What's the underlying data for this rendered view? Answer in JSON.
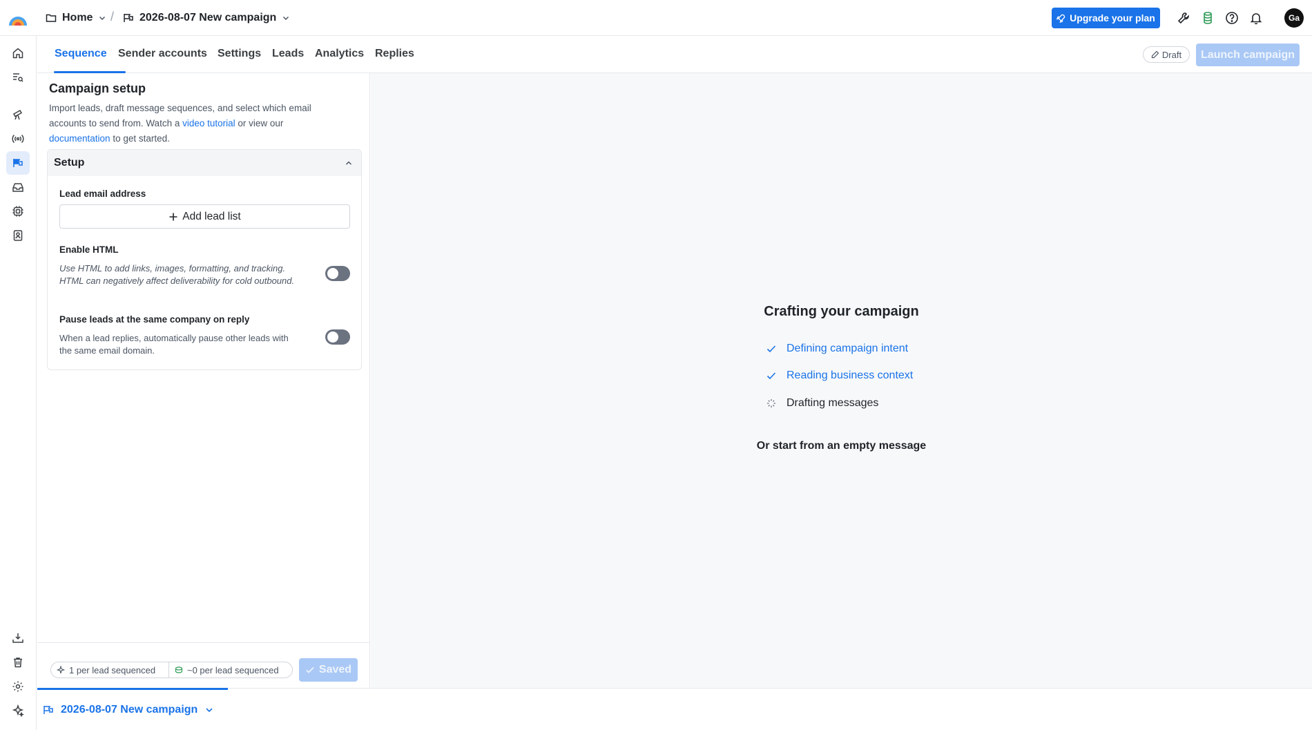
{
  "breadcrumb": {
    "home_label": "Home",
    "separator": "/",
    "campaign_label": "2026-08-07 New campaign"
  },
  "topbar": {
    "upgrade_label": "Upgrade your plan",
    "avatar_initials": "Ga",
    "icons": [
      "wrench-icon",
      "credits-icon",
      "help-icon",
      "bell-icon"
    ]
  },
  "colors": {
    "accent": "#1a73e8",
    "disabled_button": "#a9c8f5",
    "main_background": "#f7f8fa"
  },
  "tabs": [
    {
      "label": "Sequence",
      "active": true
    },
    {
      "label": "Sender accounts",
      "active": false
    },
    {
      "label": "Settings",
      "active": false
    },
    {
      "label": "Leads",
      "active": false
    },
    {
      "label": "Analytics",
      "active": false
    },
    {
      "label": "Replies",
      "active": false
    }
  ],
  "status": {
    "draft_label": "Draft",
    "launch_label": "Launch campaign"
  },
  "panel": {
    "title": "Campaign setup",
    "desc_part1": "Import leads, draft message sequences, and select which email accounts to send from. Watch a ",
    "video_link": "video tutorial",
    "desc_part2": " or view our ",
    "doc_link": "documentation",
    "desc_part3": " to get started.",
    "setup": {
      "header": "Setup",
      "lead_label": "Lead email address",
      "add_lead_label": "Add lead list",
      "html_label": "Enable HTML",
      "html_desc": "Use HTML to add links, images, formatting, and tracking. HTML can negatively affect deliverability for cold outbound.",
      "html_enabled": false,
      "pause_label": "Pause leads at the same company on reply",
      "pause_desc": "When a lead replies, automatically pause other leads with the same email domain.",
      "pause_enabled": false
    },
    "footer": {
      "credits_pill": "1 per lead sequenced",
      "cost_pill": "~0 per lead sequenced",
      "saved_label": "Saved"
    }
  },
  "main": {
    "title": "Crafting your campaign",
    "steps": [
      {
        "label": "Defining campaign intent",
        "status": "done"
      },
      {
        "label": "Reading business context",
        "status": "done"
      },
      {
        "label": "Drafting messages",
        "status": "in-progress"
      }
    ],
    "empty_link": "Or start from an empty message"
  },
  "bottom": {
    "campaign_label": "2026-08-07 New campaign"
  }
}
